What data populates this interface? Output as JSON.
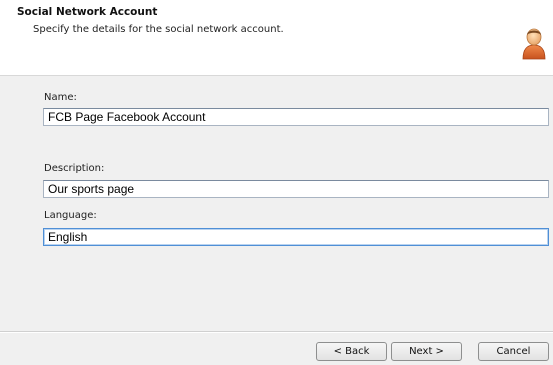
{
  "header": {
    "title": "Social Network Account",
    "subtitle": "Specify the details for the social network account."
  },
  "icons": {
    "header_icon": "user-icon"
  },
  "fields": {
    "name_label": "Name:",
    "name_value": "FCB Page Facebook Account",
    "description_label": "Description:",
    "description_value": "Our sports page",
    "language_label": "Language:",
    "language_value": "English"
  },
  "buttons": {
    "back": "< Back",
    "next": "Next >",
    "cancel": "Cancel"
  },
  "colors": {
    "focus_border": "#4f8fd6",
    "header_bg": "#ffffff",
    "dialog_bg": "#f0f0f0"
  }
}
